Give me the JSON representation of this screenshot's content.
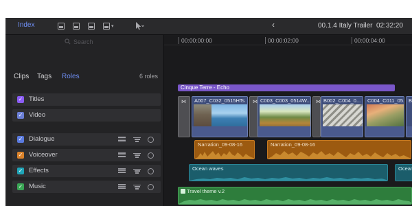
{
  "toolbar": {
    "index_label": "Index",
    "tool_icons": [
      "append-clip-icon",
      "insert-clip-icon",
      "overwrite-clip-icon",
      "connect-clip-icon",
      "arrow-tool-icon"
    ],
    "back_icon": "‹",
    "project_title": "00.1.4 Italy Trailer",
    "project_duration": "02:32:20"
  },
  "sidebar": {
    "search_placeholder": "Search",
    "tabs": [
      "Clips",
      "Tags",
      "Roles"
    ],
    "active_tab": "Roles",
    "roles_count": "6 roles",
    "roles": [
      {
        "label": "Titles",
        "color": "#8b5cf6"
      },
      {
        "label": "Video",
        "color": "#6b7fd6"
      },
      {
        "label": "Dialogue",
        "color": "#5b7be0"
      },
      {
        "label": "Voiceover",
        "color": "#d9822b"
      },
      {
        "label": "Effects",
        "color": "#1fa5b8"
      },
      {
        "label": "Music",
        "color": "#3aa655"
      }
    ]
  },
  "timeline": {
    "ruler": [
      "00:00:00:00",
      "00:00:02:00",
      "00:00:04:00"
    ],
    "title_clip": "Cinque Terre - Echo",
    "video_clips": [
      "A007_C032_0515HTs",
      "C003_C003_0514W...",
      "B002_C004_0...",
      "C004_C011_05...",
      "B"
    ],
    "narration_clips": [
      "Narration_09-08-16",
      "Narration_09-08-16"
    ],
    "effects_clips": [
      "Ocean waves",
      "Ocean"
    ],
    "music_clip": "Travel theme v.2"
  },
  "colors": {
    "accent": "#6f8ff5",
    "titles": "#7a57c9",
    "video": "#3e4d7a",
    "voiceover": "#9c5a10",
    "effects": "#1b5d6b",
    "music": "#2e7d3c"
  }
}
